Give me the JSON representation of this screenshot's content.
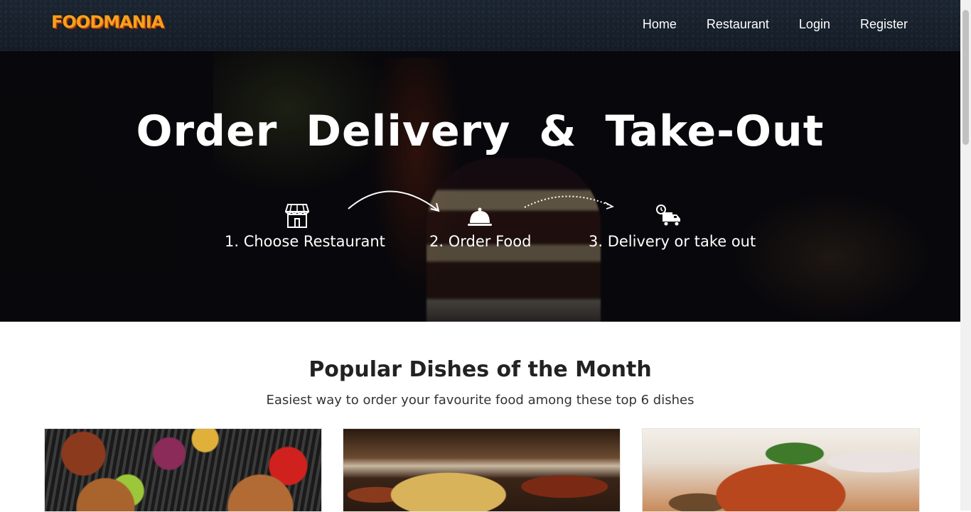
{
  "brand": {
    "logo_text": "FOODMANIA"
  },
  "nav": {
    "items": [
      {
        "label": "Home"
      },
      {
        "label": "Restaurant"
      },
      {
        "label": "Login"
      },
      {
        "label": "Register"
      }
    ]
  },
  "hero": {
    "title": "Order Delivery & Take-Out",
    "steps": [
      {
        "label": "1. Choose Restaurant",
        "icon": "storefront-icon"
      },
      {
        "label": "2. Order Food",
        "icon": "cloche-icon"
      },
      {
        "label": "3. Delivery or take out",
        "icon": "delivery-truck-icon"
      }
    ]
  },
  "popular": {
    "title": "Popular Dishes of the Month",
    "subtitle": "Easiest way to order your favourite food among these top 6 dishes"
  },
  "colors": {
    "navbar_bg": "#17202b",
    "logo": "#f5a11c",
    "hero_text": "#ffffff"
  }
}
